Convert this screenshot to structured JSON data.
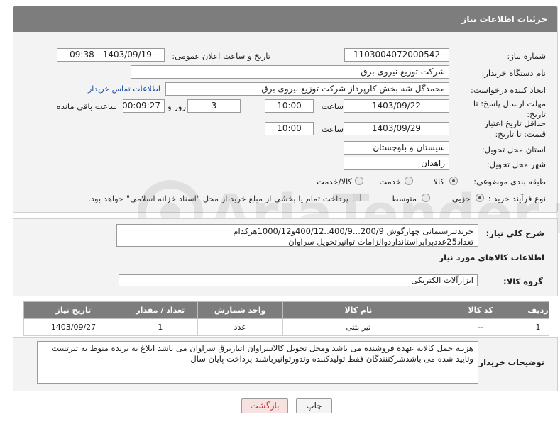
{
  "header": {
    "title": "جزئیات اطلاعات نیاز"
  },
  "fields": {
    "need_number_label": "شماره نیاز:",
    "need_number": "1103004072000542",
    "announce_label": "تاریخ و ساعت اعلان عمومی:",
    "announce_value": "1403/09/19 - 09:38",
    "buyer_label": "نام دستگاه خریدار:",
    "buyer_value": "شرکت توزیع نیروی برق",
    "creator_label": "ایجاد کننده درخواست:",
    "creator_value": "محمدگل شه بخش کارپرداز شرکت توزیع نیروی برق",
    "contact_link": "اطلاعات تماس خریدار",
    "deadline_label": "مهلت ارسال پاسخ: تا تاریخ:",
    "deadline_date": "1403/09/22",
    "time_label": "ساعت",
    "deadline_time": "10:00",
    "days_value": "3",
    "days_label": "روز و",
    "remaining_time": "00:09:27",
    "remaining_label": "ساعت باقی مانده",
    "validity_label": "حداقل تاریخ اعتبار قیمت: تا تاریخ:",
    "validity_date": "1403/09/29",
    "validity_time": "10:00",
    "province_label": "استان محل تحویل:",
    "province_value": "سیستان و بلوچستان",
    "city_label": "شهر محل تحویل:",
    "city_value": "زاهدان",
    "category_label": "طبقه بندی موضوعی:",
    "category_options": [
      "کالا",
      "خدمت",
      "کالا/خدمت"
    ],
    "category_selected": "کالا",
    "process_label": "نوع فرآیند خرید :",
    "process_options": [
      "جزیی",
      "متوسط"
    ],
    "process_selected": "جزیی",
    "payment_note": "پرداخت تمام یا بخشی از مبلغ خرید،از محل \"اسناد خزانه اسلامی\" خواهد بود."
  },
  "description": {
    "label": "شرح کلی نیاز:",
    "text": "خریدتیرسیمانی چهارگوش 200/9...400/9..400/12و1000/12هرکدام تعداد25عددبرابراستانداردوالزامات توانیرتحویل سراوان"
  },
  "goods": {
    "section_title": "اطلاعات کالاهای مورد نیاز",
    "group_label": "گروه کالا:",
    "group_value": "ابزارآلات الکتریکی",
    "columns": [
      "ردیف",
      "کد کالا",
      "نام کالا",
      "واحد شمارش",
      "تعداد / مقدار",
      "تاریخ نیاز"
    ],
    "rows": [
      {
        "index": "1",
        "code": "--",
        "name": "تیر بتنی",
        "unit": "عدد",
        "qty": "1",
        "date": "1403/09/27"
      }
    ]
  },
  "buyer_notes": {
    "label": "توضیحات خریدار:",
    "text": "هزینه حمل کالابه عهده فروشنده می باشد ومحل تحویل کالاسراوان  اتباربرق سراوان می باشد ابلاغ به برنده منوط به تیرتست وتایید شده می باشدشرکتنندگان فقط تولیدکننده وتدورتوانیرباشند پرداخت پایان سال"
  },
  "buttons": {
    "print": "چاپ",
    "back": "بازگشت"
  },
  "watermark": {
    "text": "AriaTender.neT"
  }
}
